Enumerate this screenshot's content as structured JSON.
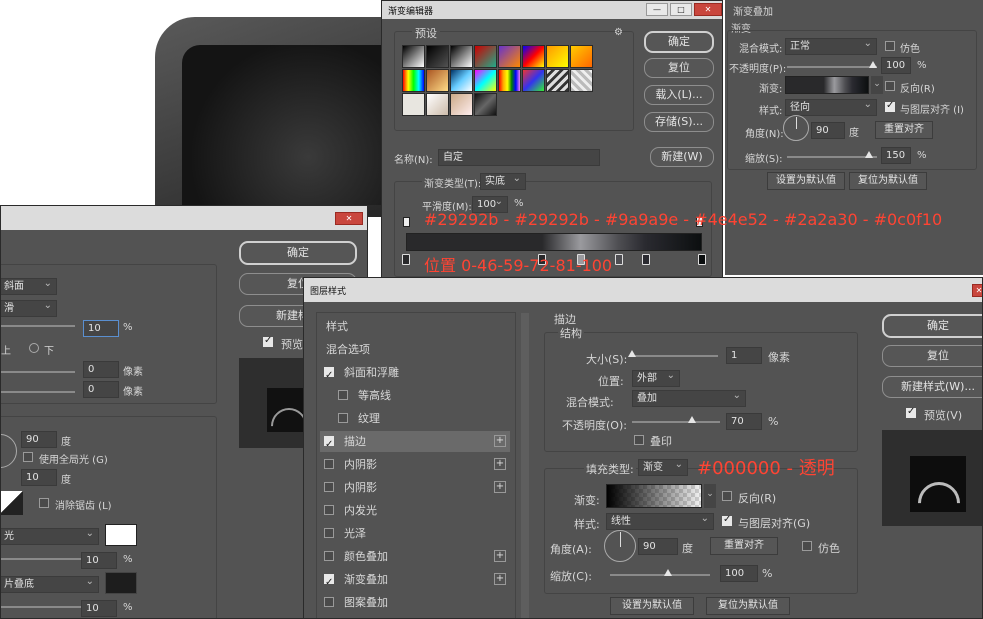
{
  "colors": {
    "panel": "#535353",
    "annotation": "#ff4433",
    "titlebar": "#d9d9d9"
  },
  "gradient_editor": {
    "title": "渐变编辑器",
    "presets_label": "预设",
    "buttons": {
      "ok": "确定",
      "reset": "复位",
      "load": "载入(L)...",
      "save": "存储(S)...",
      "new": "新建(W)"
    },
    "name_label": "名称(N):",
    "name_value": "自定",
    "type_label": "渐变类型(T):",
    "type_value": "实底",
    "smooth_label": "平滑度(M):",
    "smooth_value": "100",
    "smooth_unit": "%",
    "color_stops": [
      "#29292b",
      "#29292b",
      "#9a9a9e",
      "#4e4e52",
      "#2a2a30",
      "#0c0f10"
    ],
    "stop_positions": [
      0,
      46,
      59,
      72,
      81,
      100
    ],
    "gear_icon": "gear-icon"
  },
  "annotations": {
    "colors_text": "#29292b - #29292b - #9a9a9e - #4e4e52 - #2a2a30 - #0c0f10",
    "positions_text": "位置 0-46-59-72-81-100",
    "fill_text": "#000000 - 透明"
  },
  "gradient_overlay": {
    "title": "渐变叠加",
    "subtitle": "渐变",
    "blend_label": "混合模式:",
    "blend_value": "正常",
    "dither_label": "仿色",
    "opacity_label": "不透明度(P):",
    "opacity_value": "100",
    "pct": "%",
    "gradient_label": "渐变:",
    "reverse_label": "反向(R)",
    "style_label": "样式:",
    "style_value": "径向",
    "align_label": "与图层对齐 (I)",
    "angle_label": "角度(N):",
    "angle_value": "90",
    "deg": "度",
    "reset_align": "重置对齐",
    "scale_label": "缩放(S):",
    "scale_value": "150",
    "set_default": "设置为默认值",
    "reset_default": "复位为默认值"
  },
  "bevel_dialog": {
    "buttons": {
      "ok": "确定",
      "reset": "复位",
      "new_style": "新建样式"
    },
    "preview_label": "预览",
    "style_value": "斜面",
    "technique_value": "滑",
    "depth_value": "10",
    "pct": "%",
    "dir_up": "上",
    "dir_down": "下",
    "size_value": "0",
    "soften_value": "0",
    "pixel": "像素",
    "angle_value": "90",
    "deg": "度",
    "global_light": "使用全局光 (G)",
    "altitude_value": "10",
    "antialias": "消除锯齿 (L)",
    "highlight_mode": "光",
    "highlight_opacity": "10",
    "shadow_mode": "片叠底",
    "shadow_opacity": "10"
  },
  "layer_style": {
    "title": "图层样式",
    "sidebar": [
      {
        "label": "样式",
        "checkbox": false,
        "checked": false,
        "plus": false,
        "indent": false,
        "active": false
      },
      {
        "label": "混合选项",
        "checkbox": false,
        "checked": false,
        "plus": false,
        "indent": false,
        "active": false
      },
      {
        "label": "斜面和浮雕",
        "checkbox": true,
        "checked": true,
        "plus": false,
        "indent": false,
        "active": false
      },
      {
        "label": "等高线",
        "checkbox": true,
        "checked": false,
        "plus": false,
        "indent": true,
        "active": false
      },
      {
        "label": "纹理",
        "checkbox": true,
        "checked": false,
        "plus": false,
        "indent": true,
        "active": false
      },
      {
        "label": "描边",
        "checkbox": true,
        "checked": true,
        "plus": true,
        "indent": false,
        "active": true
      },
      {
        "label": "内阴影",
        "checkbox": true,
        "checked": false,
        "plus": true,
        "indent": false,
        "active": false
      },
      {
        "label": "内阴影",
        "checkbox": true,
        "checked": false,
        "plus": true,
        "indent": false,
        "active": false
      },
      {
        "label": "内发光",
        "checkbox": true,
        "checked": false,
        "plus": false,
        "indent": false,
        "active": false
      },
      {
        "label": "光泽",
        "checkbox": true,
        "checked": false,
        "plus": false,
        "indent": false,
        "active": false
      },
      {
        "label": "颜色叠加",
        "checkbox": true,
        "checked": false,
        "plus": true,
        "indent": false,
        "active": false
      },
      {
        "label": "渐变叠加",
        "checkbox": true,
        "checked": true,
        "plus": true,
        "indent": false,
        "active": false
      },
      {
        "label": "图案叠加",
        "checkbox": true,
        "checked": false,
        "plus": false,
        "indent": false,
        "active": false
      }
    ],
    "stroke": {
      "section": "描边",
      "structure": "结构",
      "size_label": "大小(S):",
      "size_value": "1",
      "pixel": "像素",
      "position_label": "位置:",
      "position_value": "外部",
      "blend_label": "混合模式:",
      "blend_value": "叠加",
      "opacity_label": "不透明度(O):",
      "opacity_value": "70",
      "pct": "%",
      "overprint": "叠印",
      "fill_type_label": "填充类型:",
      "fill_type_value": "渐变",
      "gradient_label": "渐变:",
      "reverse": "反向(R)",
      "style_label": "样式:",
      "style_value": "线性",
      "align": "与图层对齐(G)",
      "angle_label": "角度(A):",
      "angle_value": "90",
      "deg": "度",
      "reset_align": "重置对齐",
      "dither": "仿色",
      "scale_label": "缩放(C):",
      "scale_value": "100",
      "set_default": "设置为默认值",
      "reset_default": "复位为默认值"
    },
    "buttons": {
      "ok": "确定",
      "reset": "复位",
      "new_style": "新建样式(W)..."
    },
    "preview_label": "预览(V)"
  }
}
